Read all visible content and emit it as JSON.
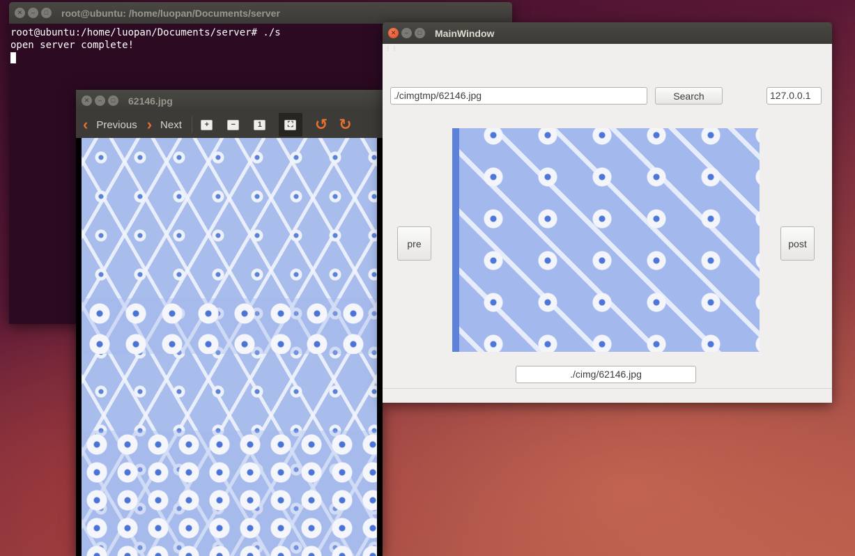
{
  "terminal": {
    "title": "root@ubuntu: /home/luopan/Documents/server",
    "lines": [
      "root@ubuntu:/home/luopan/Documents/server# ./s",
      "open server complete!"
    ]
  },
  "viewer": {
    "title": "62146.jpg",
    "previous_label": "Previous",
    "next_label": "Next",
    "tools": [
      "zoom-in-icon",
      "zoom-out-icon",
      "normal-size-icon",
      "best-fit-icon",
      "rotate-left-icon",
      "rotate-right-icon"
    ]
  },
  "mainwindow": {
    "title": "MainWindow",
    "path_input": "./cimgtmp/62146.jpg",
    "search_label": "Search",
    "ip_input": "127.0.0.1",
    "pre_label": "pre",
    "post_label": "post",
    "result_path": "./cimg/62146.jpg"
  },
  "colors": {
    "terminal_bg": "#2c0a22",
    "accent_orange": "#e6702e",
    "window_bg": "#f0efed"
  }
}
